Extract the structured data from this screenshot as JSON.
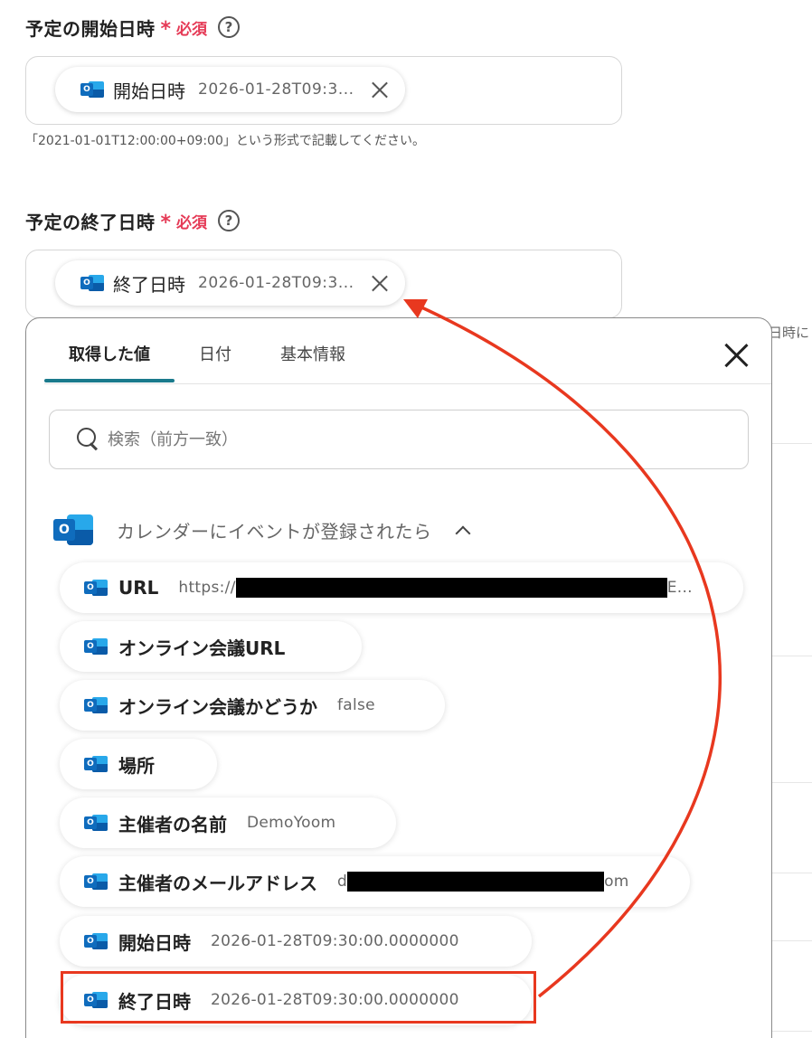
{
  "start_field": {
    "label": "予定の開始日時",
    "asterisk": "*",
    "required": "必須",
    "help_glyph": "?",
    "chip_label": "開始日時",
    "chip_value": "2026-01-28T09:3...",
    "hint": "「2021-01-01T12:00:00+09:00」という形式で記載してください。"
  },
  "end_field": {
    "label": "予定の終了日時",
    "asterisk": "*",
    "required": "必須",
    "help_glyph": "?",
    "chip_label": "終了日時",
    "chip_value": "2026-01-28T09:3..."
  },
  "background_fragment": "日時に",
  "panel": {
    "tabs": [
      {
        "label": "取得した値",
        "active": true
      },
      {
        "label": "日付",
        "active": false
      },
      {
        "label": "基本情報",
        "active": false
      }
    ],
    "search_placeholder": "検索（前方一致）",
    "group_title": "カレンダーにイベントが登録されたら",
    "items": [
      {
        "label": "URL",
        "prefix": "https://",
        "suffix": "E..."
      },
      {
        "label": "オンライン会議URL",
        "value": ""
      },
      {
        "label": "オンライン会議かどうか",
        "value": "false"
      },
      {
        "label": "場所",
        "value": ""
      },
      {
        "label": "主催者の名前",
        "value": "DemoYoom"
      },
      {
        "label": "主催者のメールアドレス",
        "prefix": "d",
        "suffix": "om"
      },
      {
        "label": "開始日時",
        "value": "2026-01-28T09:30:00.0000000"
      },
      {
        "label": "終了日時",
        "value": "2026-01-28T09:30:00.0000000"
      }
    ]
  },
  "colors": {
    "required": "#e53a56",
    "tab_indicator": "#1a7a8c",
    "annotation": "#e8381f",
    "outlook_blue": "#0f6cbd"
  },
  "icons": {
    "outlook": "outlook-icon",
    "search": "search-icon",
    "close": "close-icon",
    "help": "help-icon",
    "collapse": "chevron-up-icon"
  }
}
